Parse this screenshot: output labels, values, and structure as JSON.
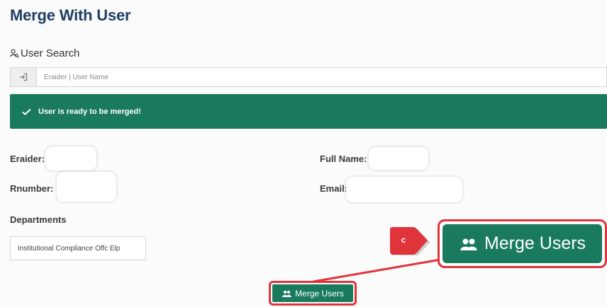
{
  "page": {
    "title": "Merge With User"
  },
  "search": {
    "label": "User Search",
    "placeholder": "Eraider | User Name",
    "label_icon": "user-search-icon",
    "addon_icon": "sign-in-icon"
  },
  "alert": {
    "message": "User is ready to be merged!",
    "icon": "check-icon",
    "color": "#1a7a5e"
  },
  "user_info": {
    "eraider_label": "Eraider:",
    "full_name_label": "Full Name:",
    "rnumber_label": "Rnumber:",
    "email_label": "Email:"
  },
  "departments": {
    "label": "Departments",
    "items": [
      "Institutional Compliance Offc Elp"
    ]
  },
  "actions": {
    "merge_label": "Merge Users",
    "merge_icon": "users-icon"
  },
  "annotation": {
    "callout_letter": "c",
    "highlight_color": "#e0343b"
  }
}
